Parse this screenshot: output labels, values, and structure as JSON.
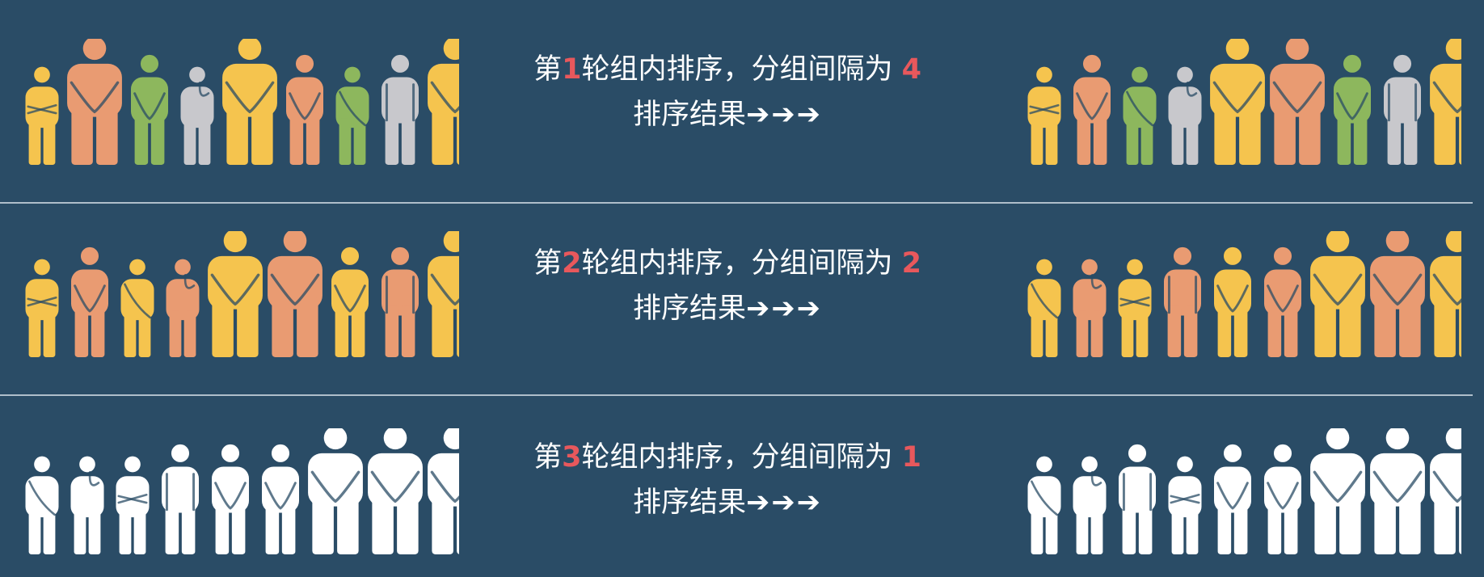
{
  "colors": {
    "background": "#2a4c66",
    "yellow": "#f5c44e",
    "orange": "#e99b72",
    "green": "#8db75d",
    "gray": "#c8c8cc",
    "white": "#ffffff",
    "highlight": "#e8585c",
    "divider": "#c7d2dc"
  },
  "rows": [
    {
      "caption": {
        "prefix": "第",
        "round": "1",
        "middle": "轮组内排序，分组间隔为 ",
        "gap": "4",
        "result": "排序结果",
        "arrows": "➔➔➔"
      },
      "before": [
        {
          "color": "yellow",
          "pose": "arms-crossed",
          "size": "small"
        },
        {
          "color": "orange",
          "pose": "hands-front",
          "size": "large"
        },
        {
          "color": "green",
          "pose": "hands-front",
          "size": "medium"
        },
        {
          "color": "gray",
          "pose": "thinking",
          "size": "small"
        },
        {
          "color": "yellow",
          "pose": "hands-front",
          "size": "large"
        },
        {
          "color": "orange",
          "pose": "hands-front",
          "size": "medium"
        },
        {
          "color": "green",
          "pose": "leaning",
          "size": "small"
        },
        {
          "color": "gray",
          "pose": "standing",
          "size": "medium"
        },
        {
          "color": "yellow",
          "pose": "hands-front",
          "size": "large"
        }
      ],
      "after": [
        {
          "color": "yellow",
          "pose": "arms-crossed",
          "size": "small"
        },
        {
          "color": "orange",
          "pose": "hands-front",
          "size": "medium"
        },
        {
          "color": "green",
          "pose": "leaning",
          "size": "small"
        },
        {
          "color": "gray",
          "pose": "thinking",
          "size": "small"
        },
        {
          "color": "yellow",
          "pose": "hands-front",
          "size": "large"
        },
        {
          "color": "orange",
          "pose": "hands-front",
          "size": "large"
        },
        {
          "color": "green",
          "pose": "hands-front",
          "size": "medium"
        },
        {
          "color": "gray",
          "pose": "standing",
          "size": "medium"
        },
        {
          "color": "yellow",
          "pose": "hands-front",
          "size": "large"
        }
      ]
    },
    {
      "caption": {
        "prefix": "第",
        "round": "2",
        "middle": "轮组内排序，分组间隔为 ",
        "gap": "2",
        "result": "排序结果",
        "arrows": "➔➔➔"
      },
      "before": [
        {
          "color": "yellow",
          "pose": "arms-crossed",
          "size": "small"
        },
        {
          "color": "orange",
          "pose": "hands-front",
          "size": "medium"
        },
        {
          "color": "yellow",
          "pose": "leaning",
          "size": "small"
        },
        {
          "color": "orange",
          "pose": "thinking",
          "size": "small"
        },
        {
          "color": "yellow",
          "pose": "hands-front",
          "size": "large"
        },
        {
          "color": "orange",
          "pose": "hands-front",
          "size": "large"
        },
        {
          "color": "yellow",
          "pose": "hands-front",
          "size": "medium"
        },
        {
          "color": "orange",
          "pose": "standing",
          "size": "medium"
        },
        {
          "color": "yellow",
          "pose": "hands-front",
          "size": "large"
        }
      ],
      "after": [
        {
          "color": "yellow",
          "pose": "leaning",
          "size": "small"
        },
        {
          "color": "orange",
          "pose": "thinking",
          "size": "small"
        },
        {
          "color": "yellow",
          "pose": "arms-crossed",
          "size": "small"
        },
        {
          "color": "orange",
          "pose": "standing",
          "size": "medium"
        },
        {
          "color": "yellow",
          "pose": "hands-front",
          "size": "medium"
        },
        {
          "color": "orange",
          "pose": "hands-front",
          "size": "medium"
        },
        {
          "color": "yellow",
          "pose": "hands-front",
          "size": "large"
        },
        {
          "color": "orange",
          "pose": "hands-front",
          "size": "large"
        },
        {
          "color": "yellow",
          "pose": "hands-front",
          "size": "large"
        }
      ]
    },
    {
      "caption": {
        "prefix": "第",
        "round": "3",
        "middle": "轮组内排序，分组间隔为 ",
        "gap": "1",
        "result": "排序结果",
        "arrows": "➔➔➔"
      },
      "before": [
        {
          "color": "white",
          "pose": "leaning",
          "size": "small"
        },
        {
          "color": "white",
          "pose": "thinking",
          "size": "small"
        },
        {
          "color": "white",
          "pose": "arms-crossed",
          "size": "small"
        },
        {
          "color": "white",
          "pose": "standing",
          "size": "medium"
        },
        {
          "color": "white",
          "pose": "hands-front",
          "size": "medium"
        },
        {
          "color": "white",
          "pose": "hands-front",
          "size": "medium"
        },
        {
          "color": "white",
          "pose": "hands-front",
          "size": "large"
        },
        {
          "color": "white",
          "pose": "hands-front",
          "size": "large"
        },
        {
          "color": "white",
          "pose": "hands-front",
          "size": "large"
        }
      ],
      "after": [
        {
          "color": "white",
          "pose": "leaning",
          "size": "small"
        },
        {
          "color": "white",
          "pose": "thinking",
          "size": "small"
        },
        {
          "color": "white",
          "pose": "standing",
          "size": "medium"
        },
        {
          "color": "white",
          "pose": "arms-crossed",
          "size": "small"
        },
        {
          "color": "white",
          "pose": "hands-front",
          "size": "medium"
        },
        {
          "color": "white",
          "pose": "hands-front",
          "size": "medium"
        },
        {
          "color": "white",
          "pose": "hands-front",
          "size": "large"
        },
        {
          "color": "white",
          "pose": "hands-front",
          "size": "large"
        },
        {
          "color": "white",
          "pose": "hands-front",
          "size": "large"
        }
      ]
    }
  ]
}
